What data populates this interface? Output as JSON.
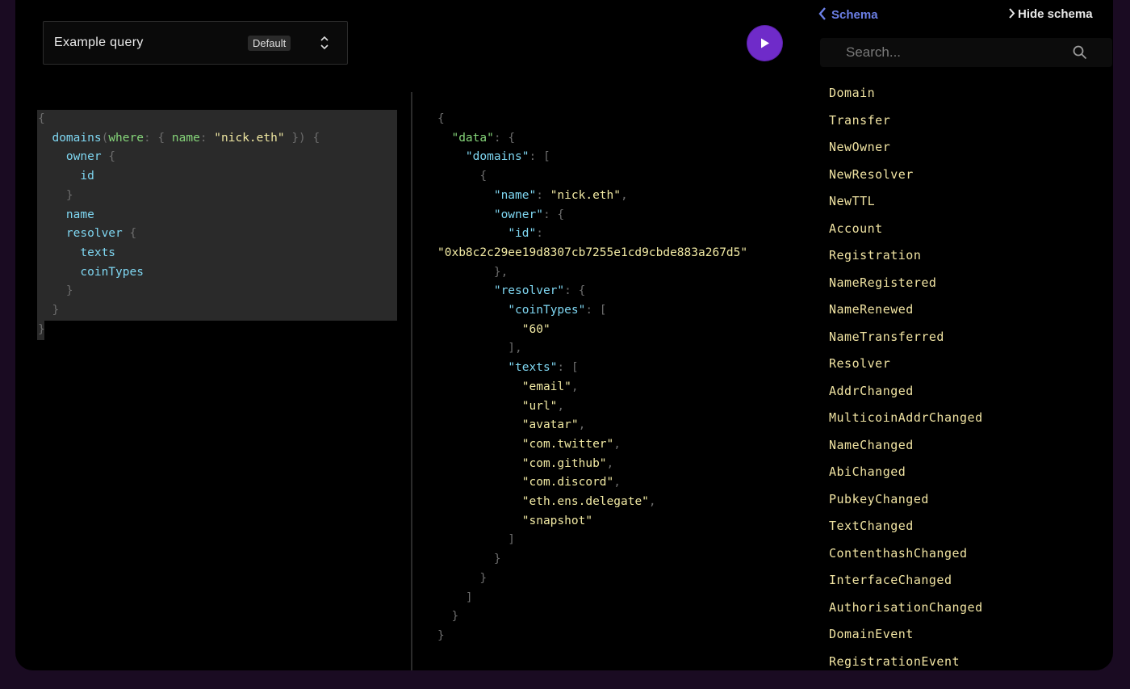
{
  "query_selector": {
    "title": "Example query",
    "badge": "Default"
  },
  "schema_panel": {
    "back_label": "Schema",
    "hide_label": "Hide schema",
    "search_placeholder": "Search...",
    "types": [
      "Domain",
      "Transfer",
      "NewOwner",
      "NewResolver",
      "NewTTL",
      "Account",
      "Registration",
      "NameRegistered",
      "NameRenewed",
      "NameTransferred",
      "Resolver",
      "AddrChanged",
      "MulticoinAddrChanged",
      "NameChanged",
      "AbiChanged",
      "PubkeyChanged",
      "TextChanged",
      "ContenthashChanged",
      "InterfaceChanged",
      "AuthorisationChanged",
      "DomainEvent",
      "RegistrationEvent"
    ]
  },
  "editor": {
    "lines": [
      [
        [
          "p",
          "{"
        ]
      ],
      [
        [
          "w",
          "  "
        ],
        [
          "f",
          "domains"
        ],
        [
          "p",
          "("
        ],
        [
          "a",
          "where"
        ],
        [
          "p",
          ": { "
        ],
        [
          "a",
          "name"
        ],
        [
          "p",
          ": "
        ],
        [
          "s",
          "\"nick.eth\""
        ],
        [
          "p",
          " }) {"
        ]
      ],
      [
        [
          "w",
          "    "
        ],
        [
          "f",
          "owner"
        ],
        [
          "p",
          " {"
        ]
      ],
      [
        [
          "w",
          "      "
        ],
        [
          "f",
          "id"
        ]
      ],
      [
        [
          "p",
          "    }"
        ]
      ],
      [
        [
          "w",
          "    "
        ],
        [
          "f",
          "name"
        ]
      ],
      [
        [
          "w",
          "    "
        ],
        [
          "f",
          "resolver"
        ],
        [
          "p",
          " {"
        ]
      ],
      [
        [
          "w",
          "      "
        ],
        [
          "f",
          "texts"
        ]
      ],
      [
        [
          "w",
          "      "
        ],
        [
          "f",
          "coinTypes"
        ]
      ],
      [
        [
          "p",
          "    }"
        ]
      ],
      [
        [
          "p",
          "  }"
        ]
      ],
      [
        [
          "p",
          "}"
        ]
      ]
    ]
  },
  "result": {
    "lines": [
      [
        [
          "p",
          "{"
        ]
      ],
      [
        [
          "w",
          "  "
        ],
        [
          "a",
          "\"data\""
        ],
        [
          "p",
          ": {"
        ]
      ],
      [
        [
          "w",
          "    "
        ],
        [
          "k",
          "\"domains\""
        ],
        [
          "p",
          ": ["
        ]
      ],
      [
        [
          "p",
          "      {"
        ]
      ],
      [
        [
          "w",
          "        "
        ],
        [
          "k",
          "\"name\""
        ],
        [
          "p",
          ": "
        ],
        [
          "s",
          "\"nick.eth\""
        ],
        [
          "p",
          ","
        ]
      ],
      [
        [
          "w",
          "        "
        ],
        [
          "k",
          "\"owner\""
        ],
        [
          "p",
          ": {"
        ]
      ],
      [
        [
          "w",
          "          "
        ],
        [
          "k",
          "\"id\""
        ],
        [
          "p",
          ":"
        ]
      ],
      [
        [
          "s",
          "\"0xb8c2c29ee19d8307cb7255e1cd9cbde883a267d5\""
        ]
      ],
      [
        [
          "p",
          "        },"
        ]
      ],
      [
        [
          "w",
          "        "
        ],
        [
          "k",
          "\"resolver\""
        ],
        [
          "p",
          ": {"
        ]
      ],
      [
        [
          "w",
          "          "
        ],
        [
          "k",
          "\"coinTypes\""
        ],
        [
          "p",
          ": ["
        ]
      ],
      [
        [
          "w",
          "            "
        ],
        [
          "s",
          "\"60\""
        ]
      ],
      [
        [
          "p",
          "          ],"
        ]
      ],
      [
        [
          "w",
          "          "
        ],
        [
          "k",
          "\"texts\""
        ],
        [
          "p",
          ": ["
        ]
      ],
      [
        [
          "w",
          "            "
        ],
        [
          "s",
          "\"email\""
        ],
        [
          "p",
          ","
        ]
      ],
      [
        [
          "w",
          "            "
        ],
        [
          "s",
          "\"url\""
        ],
        [
          "p",
          ","
        ]
      ],
      [
        [
          "w",
          "            "
        ],
        [
          "s",
          "\"avatar\""
        ],
        [
          "p",
          ","
        ]
      ],
      [
        [
          "w",
          "            "
        ],
        [
          "s",
          "\"com.twitter\""
        ],
        [
          "p",
          ","
        ]
      ],
      [
        [
          "w",
          "            "
        ],
        [
          "s",
          "\"com.github\""
        ],
        [
          "p",
          ","
        ]
      ],
      [
        [
          "w",
          "            "
        ],
        [
          "s",
          "\"com.discord\""
        ],
        [
          "p",
          ","
        ]
      ],
      [
        [
          "w",
          "            "
        ],
        [
          "s",
          "\"eth.ens.delegate\""
        ],
        [
          "p",
          ","
        ]
      ],
      [
        [
          "w",
          "            "
        ],
        [
          "s",
          "\"snapshot\""
        ]
      ],
      [
        [
          "p",
          "          ]"
        ]
      ],
      [
        [
          "p",
          "        }"
        ]
      ],
      [
        [
          "p",
          "      }"
        ]
      ],
      [
        [
          "p",
          "    ]"
        ]
      ],
      [
        [
          "p",
          "  }"
        ]
      ],
      [
        [
          "p",
          "}"
        ]
      ]
    ]
  },
  "colors": {
    "accent": "#6f2bc9",
    "schema_link": "#6b7fe6",
    "type_name": "#f0e3a2"
  }
}
